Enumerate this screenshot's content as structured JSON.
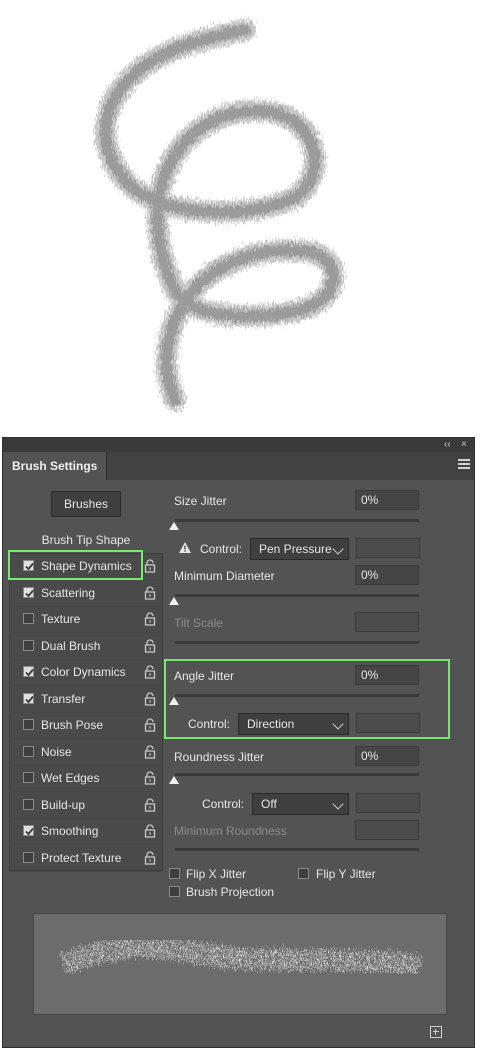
{
  "panel": {
    "title": "Brush Settings",
    "collapse_glyph": "‹‹",
    "close_glyph": "×",
    "brushes_button": "Brushes"
  },
  "options": {
    "header": "Brush Tip Shape",
    "items": [
      {
        "label": "Shape Dynamics",
        "checked": true
      },
      {
        "label": "Scattering",
        "checked": true
      },
      {
        "label": "Texture",
        "checked": false
      },
      {
        "label": "Dual Brush",
        "checked": false
      },
      {
        "label": "Color Dynamics",
        "checked": true
      },
      {
        "label": "Transfer",
        "checked": true
      },
      {
        "label": "Brush Pose",
        "checked": false
      },
      {
        "label": "Noise",
        "checked": false
      },
      {
        "label": "Wet Edges",
        "checked": false
      },
      {
        "label": "Build-up",
        "checked": false
      },
      {
        "label": "Smoothing",
        "checked": true
      },
      {
        "label": "Protect Texture",
        "checked": false
      }
    ]
  },
  "settings": {
    "size_jitter": {
      "label": "Size Jitter",
      "value": "0%"
    },
    "control1": {
      "label": "Control:",
      "value": "Pen Pressure"
    },
    "min_diameter": {
      "label": "Minimum Diameter",
      "value": "0%"
    },
    "tilt_scale": {
      "label": "Tilt Scale"
    },
    "angle_jitter": {
      "label": "Angle Jitter",
      "value": "0%"
    },
    "control2": {
      "label": "Control:",
      "value": "Direction"
    },
    "roundness_jitter": {
      "label": "Roundness Jitter",
      "value": "0%"
    },
    "control3": {
      "label": "Control:",
      "value": "Off"
    },
    "min_roundness": {
      "label": "Minimum Roundness"
    },
    "flip_x": "Flip X Jitter",
    "flip_y": "Flip Y Jitter",
    "brush_projection": "Brush Projection"
  },
  "colors": {
    "panel_bg": "#535353",
    "highlight": "#79e870",
    "stroke": "#8a8a8a"
  },
  "icons": [
    "collapse-icon",
    "close-icon",
    "panel-menu-icon",
    "lock-icon",
    "warning-icon",
    "chevron-down-icon",
    "new-preset-icon"
  ]
}
